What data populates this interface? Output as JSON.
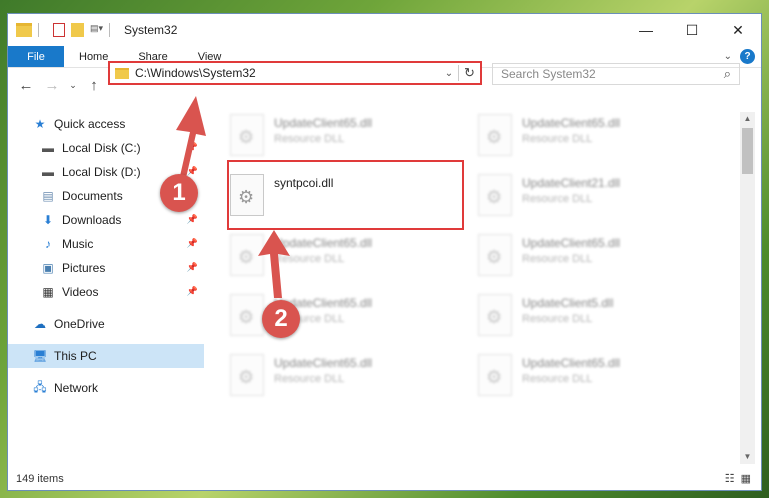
{
  "window": {
    "title": "System32"
  },
  "ribbon": {
    "tabs": [
      "File",
      "Home",
      "Share",
      "View"
    ]
  },
  "address": {
    "path": "C:\\Windows\\System32"
  },
  "search": {
    "placeholder": "Search System32"
  },
  "sidebar": {
    "items": [
      {
        "label": "Quick access",
        "icon": "star-icon",
        "level": "top"
      },
      {
        "label": "Local Disk (C:)",
        "icon": "drive-icon",
        "level": "sub",
        "pinned": true
      },
      {
        "label": "Local Disk (D:)",
        "icon": "drive-icon",
        "level": "sub",
        "pinned": true
      },
      {
        "label": "Documents",
        "icon": "documents-icon",
        "level": "sub",
        "pinned": true
      },
      {
        "label": "Downloads",
        "icon": "download-icon",
        "level": "sub",
        "pinned": true
      },
      {
        "label": "Music",
        "icon": "music-icon",
        "level": "sub",
        "pinned": true
      },
      {
        "label": "Pictures",
        "icon": "pictures-icon",
        "level": "sub",
        "pinned": true
      },
      {
        "label": "Videos",
        "icon": "videos-icon",
        "level": "sub",
        "pinned": true
      },
      {
        "label": "OneDrive",
        "icon": "cloud-icon",
        "level": "top"
      },
      {
        "label": "This PC",
        "icon": "computer-icon",
        "level": "top",
        "selected": true
      },
      {
        "label": "Network",
        "icon": "network-icon",
        "level": "top"
      }
    ]
  },
  "files": [
    {
      "name": "UpdateClient65.dll",
      "type": "Resource DLL"
    },
    {
      "name": "UpdateClient65.dll",
      "type": "Resource DLL"
    },
    {
      "name": "syntpcoi.dll",
      "type": ""
    },
    {
      "name": "UpdateClient21.dll",
      "type": "Resource DLL"
    },
    {
      "name": "UpdateClient65.dll",
      "type": "Resource DLL"
    },
    {
      "name": "UpdateClient65.dll",
      "type": "Resource DLL"
    },
    {
      "name": "UpdateClient65.dll",
      "type": "Resource DLL"
    },
    {
      "name": "UpdateClient5.dll",
      "type": "Resource DLL"
    },
    {
      "name": "UpdateClient65.dll",
      "type": "Resource DLL"
    },
    {
      "name": "UpdateClient65.dll",
      "type": "Resource DLL"
    }
  ],
  "status": {
    "item_count": "149 items"
  },
  "annotations": {
    "badge1": "1",
    "badge2": "2",
    "color": "#d9544f"
  }
}
